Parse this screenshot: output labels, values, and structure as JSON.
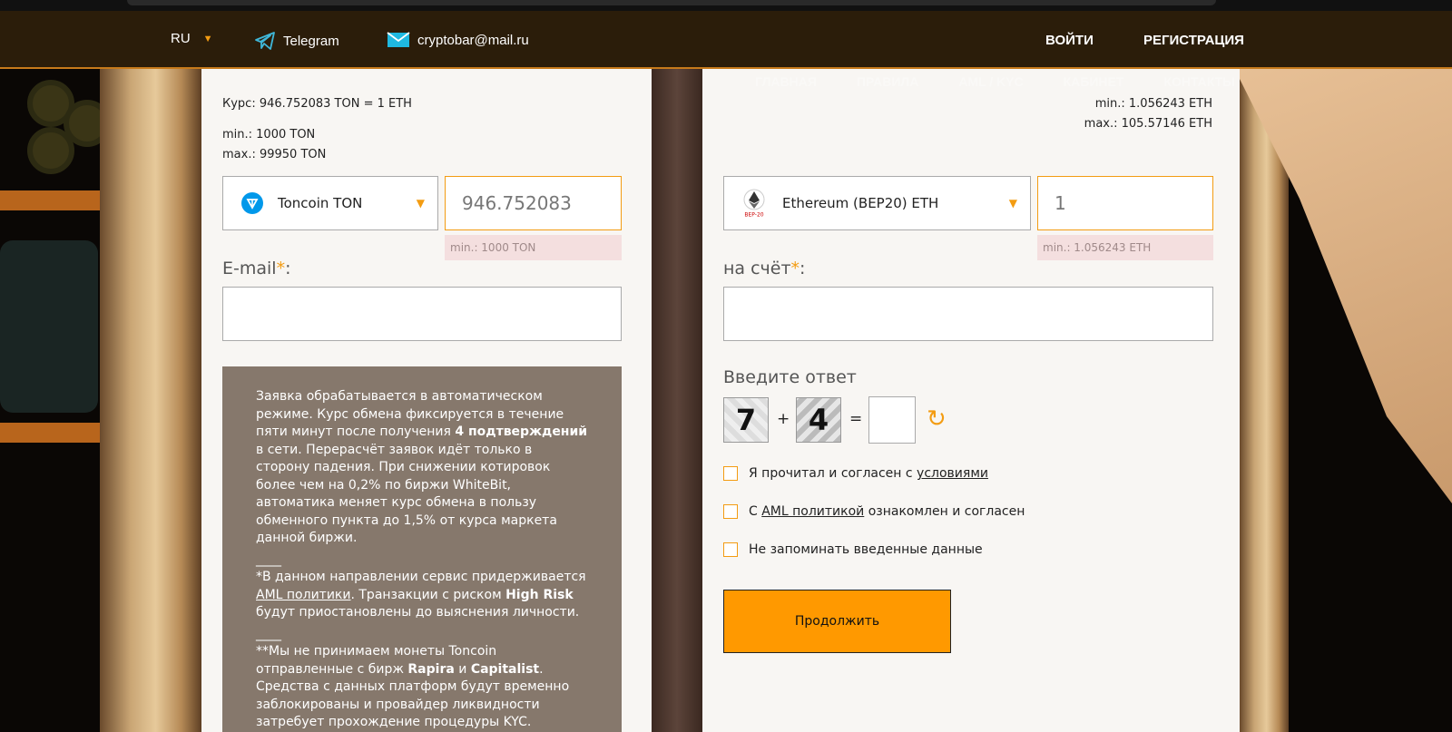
{
  "header": {
    "lang": "RU",
    "telegram": "Telegram",
    "email": "cryptobar@mail.ru",
    "login": "ВОЙТИ",
    "register": "РЕГИСТРАЦИЯ"
  },
  "nav": [
    "ГЛАВНАЯ",
    "ПРАВИЛА",
    "AML / KYC",
    "КАБИНЕТ",
    "КОНТАКТЫ"
  ],
  "give": {
    "rate": "Курс: 946.752083 TON = 1 ETH",
    "min": "min.: 1000 TON",
    "max": "max.: 99950 TON",
    "currency": "Toncoin TON",
    "amount": "946.752083",
    "hint": "min.: 1000 TON",
    "email_label": "E-mail",
    "required_mark": "*",
    "label_suffix": ":"
  },
  "get": {
    "min": "min.: 1.056243 ETH",
    "max": "max.: 105.57146 ETH",
    "currency": "Ethereum (BEP20) ETH",
    "amount": "1",
    "hint": "min.: 1.056243 ETH",
    "account_label": "на счёт",
    "required_mark": "*",
    "label_suffix": ":"
  },
  "notice": {
    "p1a": "Заявка обрабатывается в автоматическом режиме. Курс обмена фиксируется в течение пяти минут после получения ",
    "p1b": "4 подтверждений",
    "p1c": " в сети. Перерасчёт заявок идёт только в сторону падения. При снижении котировок более чем на 0,2% по биржи WhiteBit, автоматика меняет курс обмена в пользу обменного пункта до 1,5% от курса маркета данной биржи.",
    "sep": "____",
    "p2a": "*В данном направлении сервис придерживается ",
    "p2link": "AML политики",
    "p2b": ". Транзакции с риском ",
    "p2c": "High Risk",
    "p2d": " будут приостановлены до выяснения личности.",
    "p3a": "**Мы не принимаем монеты Toncoin отправленные с бирж ",
    "p3b": "Rapira",
    "p3c": " и ",
    "p3d": "Capitalist",
    "p3e": ". Средства с данных платформ будут временно заблокированы и провайдер ликвидности затребует прохождение процедуры KYC."
  },
  "captcha": {
    "title": "Введите ответ",
    "a": "7",
    "plus": "+",
    "b": "4",
    "eq": "="
  },
  "checks": {
    "terms_a": "Я прочитал и согласен с ",
    "terms_link": "условиями",
    "aml_a": "С ",
    "aml_link": "AML политикой",
    "aml_b": " ознакомлен и согласен",
    "remember": "Не запоминать введенные данные"
  },
  "continue": "Продолжить",
  "colors": {
    "accent": "#ff9900",
    "header_bg": "#2b1d0a",
    "notice_bg": "#86786c"
  }
}
